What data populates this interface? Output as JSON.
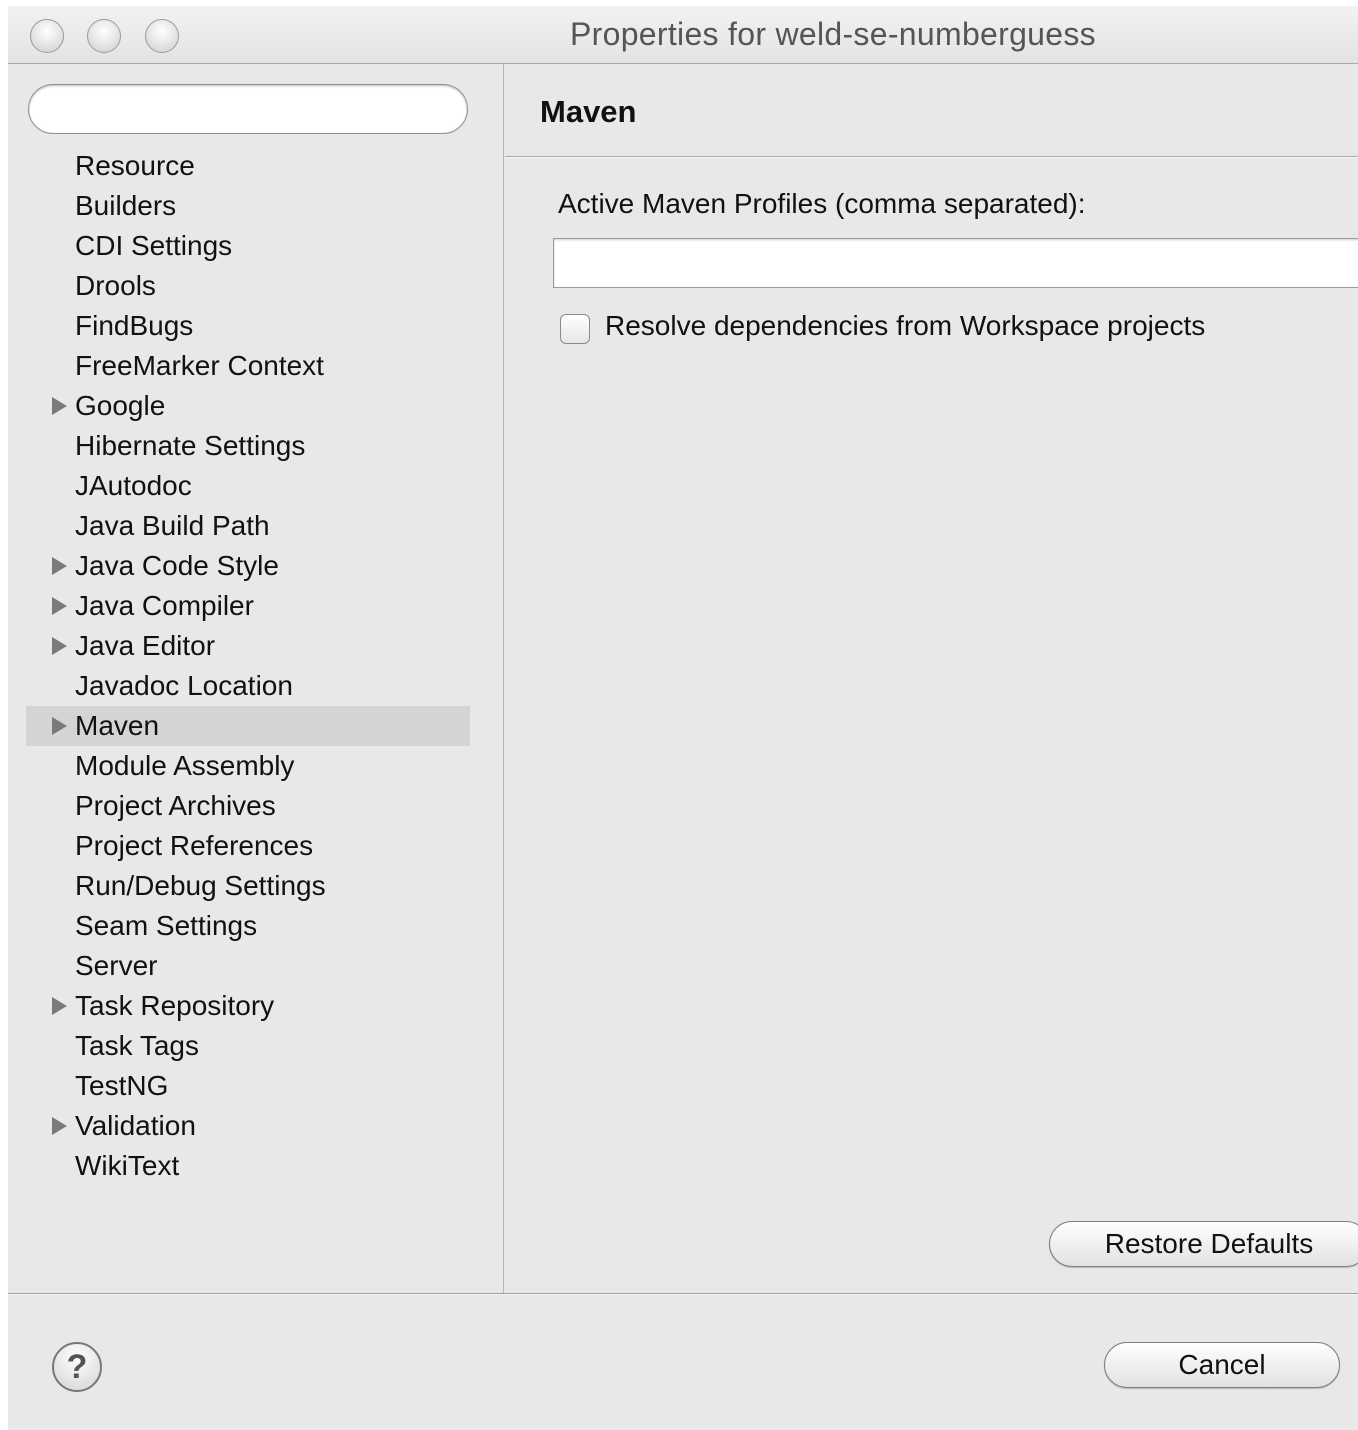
{
  "window": {
    "title": "Properties for weld-se-numberguess"
  },
  "filter": {
    "value": "",
    "placeholder": ""
  },
  "tree": {
    "items": [
      {
        "label": "Resource",
        "expandable": false,
        "selected": false
      },
      {
        "label": "Builders",
        "expandable": false,
        "selected": false
      },
      {
        "label": "CDI Settings",
        "expandable": false,
        "selected": false
      },
      {
        "label": "Drools",
        "expandable": false,
        "selected": false
      },
      {
        "label": "FindBugs",
        "expandable": false,
        "selected": false
      },
      {
        "label": "FreeMarker Context",
        "expandable": false,
        "selected": false
      },
      {
        "label": "Google",
        "expandable": true,
        "selected": false
      },
      {
        "label": "Hibernate Settings",
        "expandable": false,
        "selected": false
      },
      {
        "label": "JAutodoc",
        "expandable": false,
        "selected": false
      },
      {
        "label": "Java Build Path",
        "expandable": false,
        "selected": false
      },
      {
        "label": "Java Code Style",
        "expandable": true,
        "selected": false
      },
      {
        "label": "Java Compiler",
        "expandable": true,
        "selected": false
      },
      {
        "label": "Java Editor",
        "expandable": true,
        "selected": false
      },
      {
        "label": "Javadoc Location",
        "expandable": false,
        "selected": false
      },
      {
        "label": "Maven",
        "expandable": true,
        "selected": true
      },
      {
        "label": "Module Assembly",
        "expandable": false,
        "selected": false
      },
      {
        "label": "Project Archives",
        "expandable": false,
        "selected": false
      },
      {
        "label": "Project References",
        "expandable": false,
        "selected": false
      },
      {
        "label": "Run/Debug Settings",
        "expandable": false,
        "selected": false
      },
      {
        "label": "Seam Settings",
        "expandable": false,
        "selected": false
      },
      {
        "label": "Server",
        "expandable": false,
        "selected": false
      },
      {
        "label": "Task Repository",
        "expandable": true,
        "selected": false
      },
      {
        "label": "Task Tags",
        "expandable": false,
        "selected": false
      },
      {
        "label": "TestNG",
        "expandable": false,
        "selected": false
      },
      {
        "label": "Validation",
        "expandable": true,
        "selected": false
      },
      {
        "label": "WikiText",
        "expandable": false,
        "selected": false
      }
    ]
  },
  "page": {
    "title": "Maven",
    "profiles_label": "Active Maven Profiles (comma separated):",
    "profiles_value": "",
    "resolve_checkbox_label": "Resolve dependencies from Workspace projects",
    "resolve_checked": false,
    "restore_defaults_label": "Restore Defaults"
  },
  "footer": {
    "help_glyph": "?",
    "cancel_label": "Cancel"
  },
  "icons": {
    "expand": "triangle-right-icon",
    "help": "help-icon"
  },
  "colors": {
    "selection": "#d4d4d4",
    "window_bg": "#e8e8e8"
  }
}
